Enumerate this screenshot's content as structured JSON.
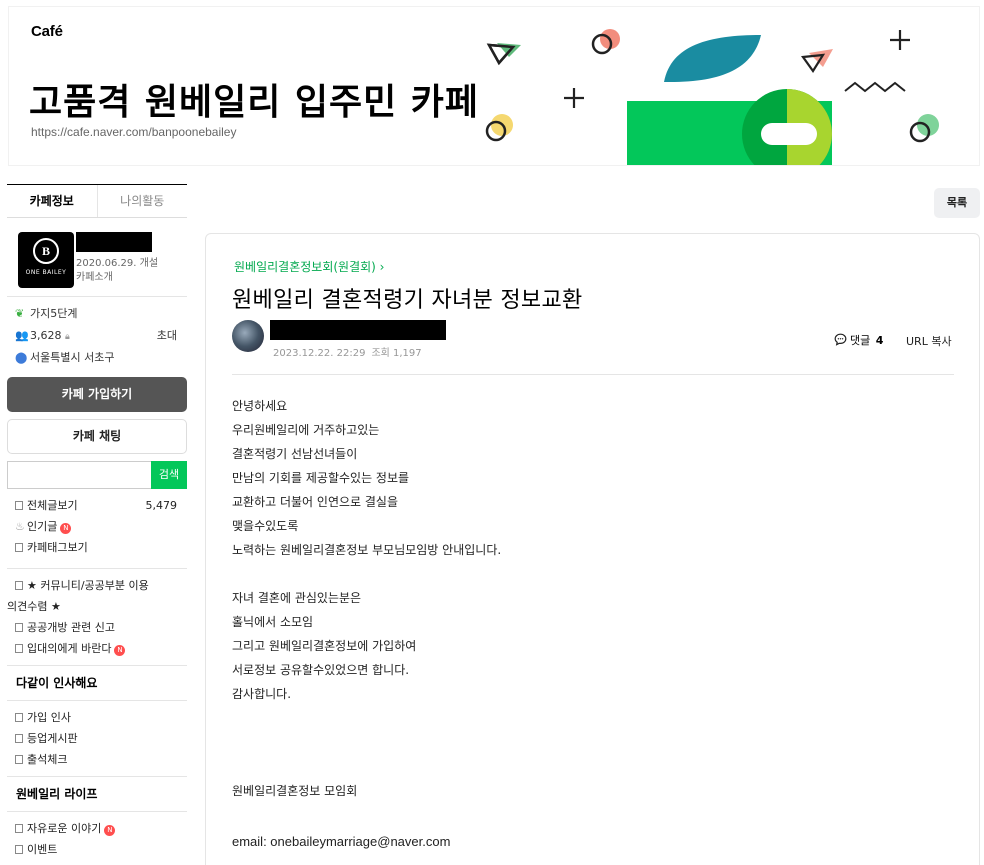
{
  "banner": {
    "brand": "Café",
    "title": "고품격 원베일리 입주민 카페",
    "url": "https://cafe.naver.com/banpoonebailey"
  },
  "sidebar": {
    "tabs": [
      "카페정보",
      "나의활동"
    ],
    "logo_text": "ONE BAILEY",
    "logo_letter": "B",
    "open_date": "2020.06.29. 개설",
    "intro_link": "카페소개",
    "level": "가지5단계",
    "members": "3,628",
    "invite": "초대",
    "location": "서울특별시 서초구",
    "join_button": "카페 가입하기",
    "chat_button": "카페 채팅",
    "search_button": "검색",
    "menu_main": [
      {
        "label": "전체글보기",
        "count": "5,479"
      },
      {
        "label": "인기글",
        "new": "N"
      },
      {
        "label": "카페태그보기"
      }
    ],
    "menu_community": [
      {
        "label": "★ 커뮤니티/공공부분 이용",
        "continuation": "의견수렴 ★"
      },
      {
        "label": "공공개방 관련 신고"
      },
      {
        "label": "입대의에게 바란다",
        "new": "N"
      }
    ],
    "group_greet": "다같이 인사해요",
    "menu_greet": [
      "가입 인사",
      "등업게시판",
      "출석체크"
    ],
    "group_life": "원베일리 라이프",
    "menu_life": [
      {
        "label": "자유로운 이야기",
        "new": "N"
      },
      {
        "label": "이벤트"
      }
    ]
  },
  "list_button": "목록",
  "article": {
    "board": "원베일리결혼정보회(원결회) ›",
    "title": "원베일리 결혼적령기 자녀분 정보교환",
    "date": "2023.12.22. 22:29",
    "views": "조회 1,197",
    "comments_label": "댓글",
    "comments_count": "4",
    "url_copy": "URL 복사",
    "body": [
      "안녕하세요",
      "우리원베일리에 거주하고있는",
      "결혼적령기 선남선녀들이",
      "만남의 기회를 제공할수있는 정보를",
      "교환하고 더불어 인연으로 결실을",
      "맺을수있도록",
      "노력하는 원베일리결혼정보 부모님모임방 안내입니다.",
      "",
      "자녀 결혼에 관심있는분은",
      "홀닉에서 소모임",
      "그리고 원베일리결혼정보에 가입하여",
      "서로정보 공유할수있었으면 합니다.",
      "감사합니다."
    ],
    "signature": "원베일리결혼정보 모임회",
    "email": "email: onebaileymarriage@naver.com"
  },
  "colors": {
    "naver_green": "#03c75a",
    "board_green": "#03a94f",
    "join_button": "#555555",
    "new_badge": "#ff4e4e"
  }
}
